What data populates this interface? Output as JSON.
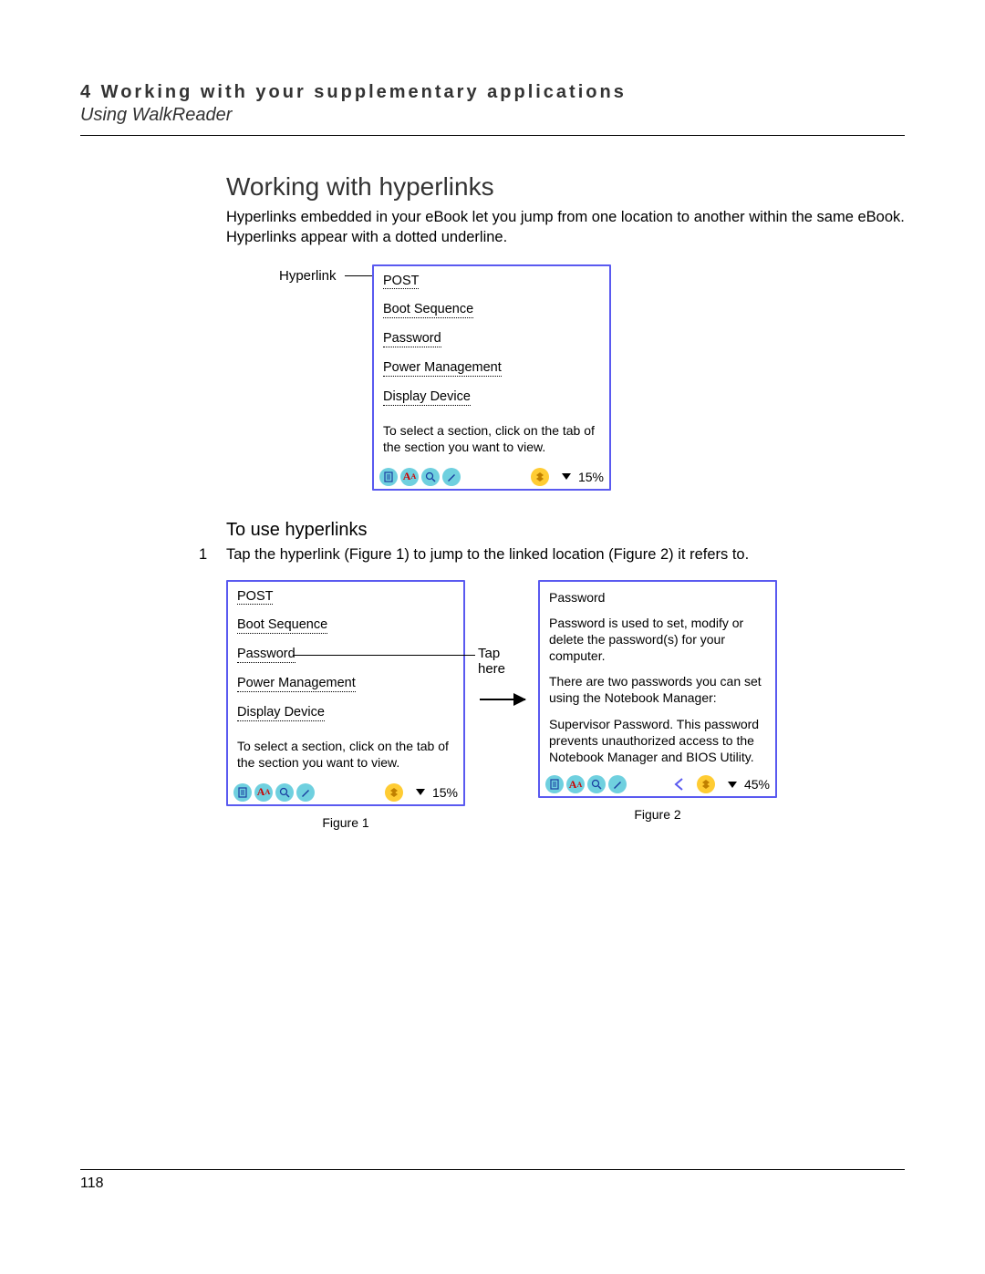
{
  "header": {
    "chapter": "4 Working with your supplementary applications",
    "sub": "Using WalkReader"
  },
  "section_title": "Working with hyperlinks",
  "intro": "Hyperlinks embedded in your eBook let you jump from one location to another within the same eBook. Hyperlinks appear with a dotted underline.",
  "callout_hyperlink": "Hyperlink",
  "panel1": {
    "links": [
      "POST",
      "Boot Sequence",
      "Password",
      "Power Management",
      "Display Device"
    ],
    "note": "To select a section, click on the tab of the section you want to view.",
    "percent": "15%"
  },
  "sub_title": "To use hyperlinks",
  "step": {
    "num": "1",
    "text": "Tap the hyperlink (Figure 1) to jump to the linked location (Figure 2) it refers to."
  },
  "tap_here": "Tap here",
  "fig1": {
    "links": [
      "POST",
      "Boot Sequence",
      "Password",
      "Power Management",
      "Display Device"
    ],
    "note": "To select a section, click on the tab of the section you want to view.",
    "percent": "15%",
    "caption": "Figure 1"
  },
  "fig2": {
    "title": "Password",
    "para1": "Password is used to set, modify or delete the password(s) for your computer.",
    "para2": "There are two passwords you can set using the Notebook Manager:",
    "para3": "Supervisor Password. This password prevents unauthorized access to the Notebook Manager and BIOS Utility.",
    "percent": "45%",
    "caption": "Figure 2"
  },
  "page_number": "118"
}
